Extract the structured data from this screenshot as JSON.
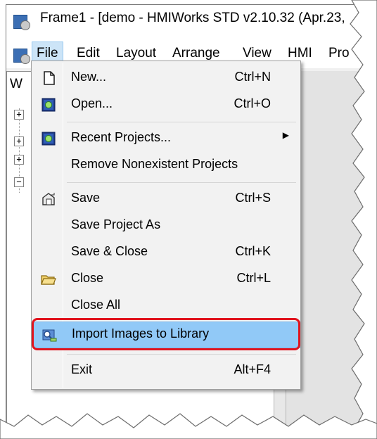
{
  "window": {
    "title": "Frame1 - [demo - HMIWorks STD v2.10.32 (Apr.23,"
  },
  "menubar": [
    "File",
    "Edit",
    "Layout",
    "Arrange",
    "View",
    "HMI",
    "Pro"
  ],
  "panel": {
    "title": "W"
  },
  "file_menu": {
    "items": [
      {
        "label": "New...",
        "shortcut": "Ctrl+N",
        "icon": "new-document-icon"
      },
      {
        "label": "Open...",
        "shortcut": "Ctrl+O",
        "icon": "open-project-icon"
      },
      {
        "label": "Recent Projects...",
        "shortcut": "",
        "icon": "recent-projects-icon",
        "submenu": true
      },
      {
        "label": "Remove Nonexistent Projects",
        "shortcut": ""
      },
      {
        "label": "Save",
        "shortcut": "Ctrl+S",
        "icon": "save-icon"
      },
      {
        "label": "Save Project As",
        "shortcut": ""
      },
      {
        "label": "Save & Close",
        "shortcut": "Ctrl+K"
      },
      {
        "label": "Close",
        "shortcut": "Ctrl+L",
        "icon": "folder-close-icon"
      },
      {
        "label": "Close All",
        "shortcut": ""
      },
      {
        "label": "Import Images to Library",
        "shortcut": "",
        "icon": "import-images-icon",
        "highlighted": true
      },
      {
        "label": "Exit",
        "shortcut": "Alt+F4"
      }
    ]
  },
  "colors": {
    "highlight": "#91c9f7",
    "callout_border": "#e0141e",
    "menubar_active": "#cce4f7"
  }
}
